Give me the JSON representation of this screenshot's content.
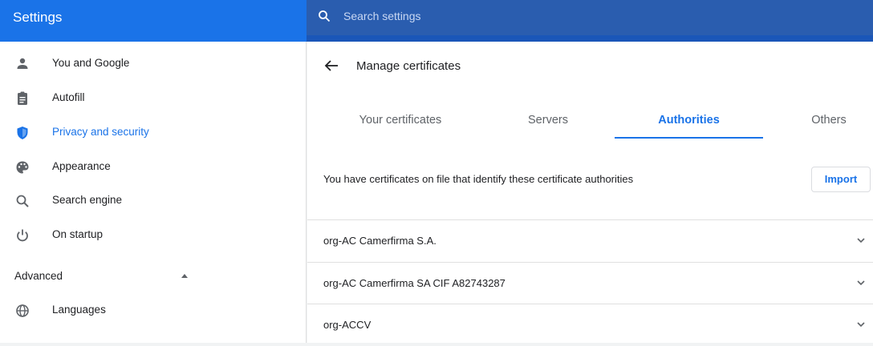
{
  "header": {
    "title": "Settings",
    "search_placeholder": "Search settings"
  },
  "sidebar": {
    "items": [
      {
        "label": "You and Google",
        "icon": "person-icon"
      },
      {
        "label": "Autofill",
        "icon": "clipboard-icon"
      },
      {
        "label": "Privacy and security",
        "icon": "shield-icon",
        "active": true
      },
      {
        "label": "Appearance",
        "icon": "palette-icon"
      },
      {
        "label": "Search engine",
        "icon": "search-icon"
      },
      {
        "label": "On startup",
        "icon": "power-icon"
      }
    ],
    "advanced_label": "Advanced",
    "advanced_items": [
      {
        "label": "Languages",
        "icon": "globe-icon"
      }
    ]
  },
  "main": {
    "title": "Manage certificates",
    "tabs": [
      {
        "label": "Your certificates"
      },
      {
        "label": "Servers"
      },
      {
        "label": "Authorities",
        "active": true
      },
      {
        "label": "Others"
      }
    ],
    "description": "You have certificates on file that identify these certificate authorities",
    "import_label": "Import",
    "certificates": [
      {
        "name": "org-AC Camerfirma S.A."
      },
      {
        "name": "org-AC Camerfirma SA CIF A82743287"
      },
      {
        "name": "org-ACCV"
      }
    ]
  },
  "colors": {
    "accent": "#1a73e8",
    "header_dark": "#1a56b8"
  }
}
